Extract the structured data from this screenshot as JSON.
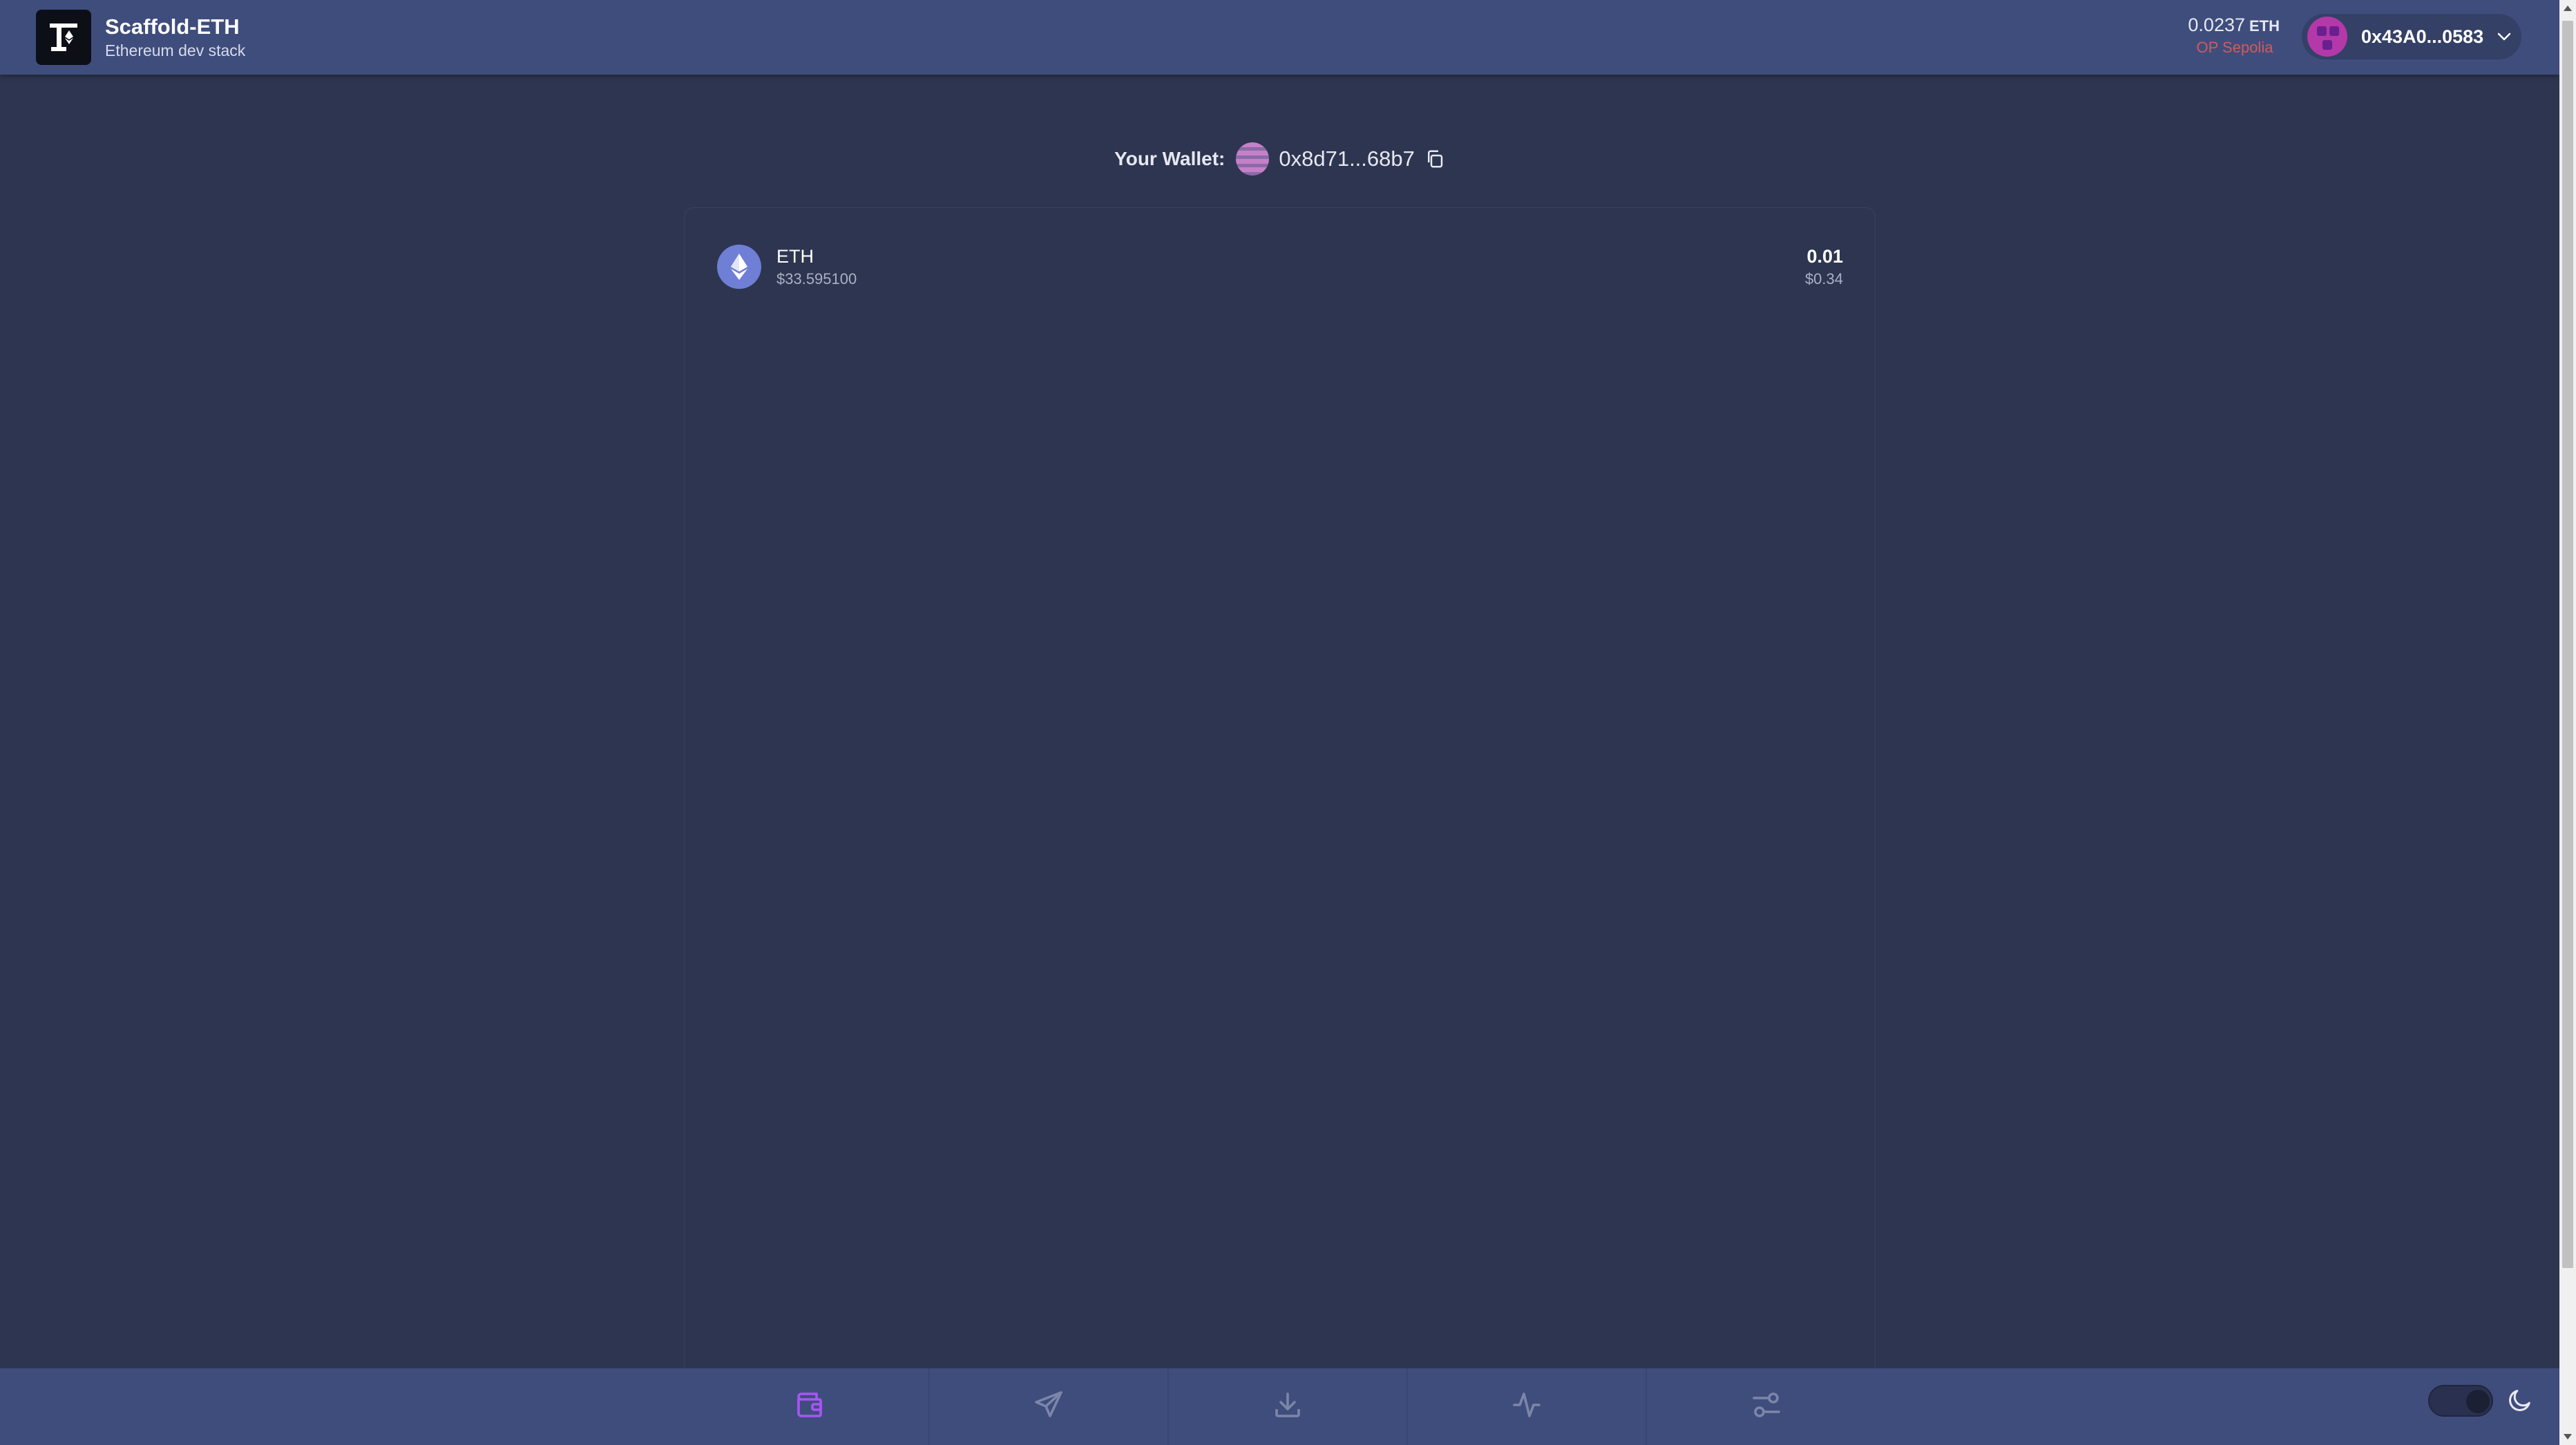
{
  "header": {
    "title": "Scaffold-ETH",
    "subtitle": "Ethereum dev stack",
    "balance": {
      "amount": "0.0237",
      "unit": "ETH",
      "network": "OP Sepolia"
    },
    "account": {
      "address": "0x43A0...0583"
    }
  },
  "wallet": {
    "label": "Your Wallet:",
    "address": "0x8d71...68b7"
  },
  "tokens": [
    {
      "symbol": "ETH",
      "price": "$33.595100",
      "amount": "0.01",
      "usd_value": "$0.34"
    }
  ],
  "bottom_nav": {
    "items": [
      {
        "name": "wallet",
        "icon": "wallet-icon",
        "active": true
      },
      {
        "name": "send",
        "icon": "send-icon",
        "active": false
      },
      {
        "name": "receive",
        "icon": "download-icon",
        "active": false
      },
      {
        "name": "activity",
        "icon": "activity-icon",
        "active": false
      },
      {
        "name": "settings",
        "icon": "sliders-icon",
        "active": false
      }
    ]
  },
  "colors": {
    "background": "#2e3550",
    "header": "#3f4d7d",
    "accent": "#a855f7",
    "network": "#d35a5a",
    "eth_icon": "#6f7fd6"
  }
}
